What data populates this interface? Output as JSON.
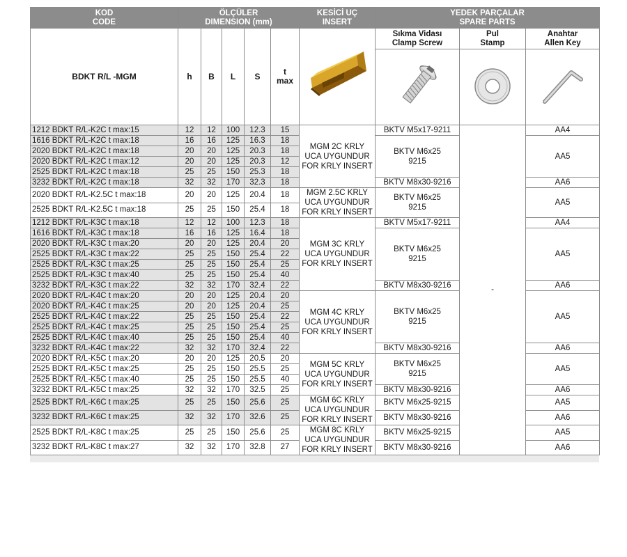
{
  "headers": {
    "code": [
      "KOD",
      "CODE"
    ],
    "dimensions": [
      "ÖLÇÜLER",
      "DIMENSION (mm)"
    ],
    "insert": [
      "KESİCİ UÇ",
      "INSERT"
    ],
    "spare_parts": [
      "YEDEK PARÇALAR",
      "SPARE PARTS"
    ],
    "clamp_screw": [
      "Sıkma Vidası",
      "Clamp Screw"
    ],
    "stamp": [
      "Pul",
      "Stamp"
    ],
    "allen_key": [
      "Anahtar",
      "Allen Key"
    ],
    "model": "BDKT R/L -MGM",
    "h": "h",
    "B": "B",
    "L": "L",
    "S": "S",
    "tmax": [
      "t",
      "max"
    ]
  },
  "icons": {
    "insert": "insert-image",
    "screw": "screw-icon",
    "washer": "washer-icon",
    "key": "allen-key-icon"
  },
  "colors": {
    "header_bg": "#8c8c8c",
    "row_shade": "#e3e3e3",
    "insert_gold": "#c9961f"
  },
  "stamp_value": "-",
  "rows": [
    {
      "code": "1212 BDKT R/L-K2C t max:15",
      "h": "12",
      "B": "12",
      "L": "100",
      "S": "12.3",
      "t": "15"
    },
    {
      "code": "1616 BDKT R/L-K2C t max:18",
      "h": "16",
      "B": "16",
      "L": "125",
      "S": "16.3",
      "t": "18"
    },
    {
      "code": "2020 BDKT R/L-K2C t max:18",
      "h": "20",
      "B": "20",
      "L": "125",
      "S": "20.3",
      "t": "18"
    },
    {
      "code": "2020 BDKT R/L-K2C t max:12",
      "h": "20",
      "B": "20",
      "L": "125",
      "S": "20.3",
      "t": "12"
    },
    {
      "code": "2525 BDKT R/L-K2C t max:18",
      "h": "25",
      "B": "25",
      "L": "150",
      "S": "25.3",
      "t": "18"
    },
    {
      "code": "3232 BDKT R/L-K2C t max:18",
      "h": "32",
      "B": "32",
      "L": "170",
      "S": "32.3",
      "t": "18"
    },
    {
      "code": "2020 BDKT R/L-K2.5C t max:18",
      "h": "20",
      "B": "20",
      "L": "125",
      "S": "20.4",
      "t": "18"
    },
    {
      "code": "2525 BDKT R/L-K2.5C t max:18",
      "h": "25",
      "B": "25",
      "L": "150",
      "S": "25.4",
      "t": "18"
    },
    {
      "code": "1212 BDKT R/L-K3C t max:18",
      "h": "12",
      "B": "12",
      "L": "100",
      "S": "12.3",
      "t": "18"
    },
    {
      "code": "1616 BDKT R/L-K3C t max:18",
      "h": "16",
      "B": "16",
      "L": "125",
      "S": "16.4",
      "t": "18"
    },
    {
      "code": "2020 BDKT R/L-K3C t max:20",
      "h": "20",
      "B": "20",
      "L": "125",
      "S": "20.4",
      "t": "20"
    },
    {
      "code": "2525 BDKT R/L-K3C t max:22",
      "h": "25",
      "B": "25",
      "L": "150",
      "S": "25.4",
      "t": "22"
    },
    {
      "code": "2525 BDKT R/L-K3C t max:25",
      "h": "25",
      "B": "25",
      "L": "150",
      "S": "25.4",
      "t": "25"
    },
    {
      "code": "2525 BDKT R/L-K3C t max:40",
      "h": "25",
      "B": "25",
      "L": "150",
      "S": "25.4",
      "t": "40"
    },
    {
      "code": "3232 BDKT R/L-K3C t max:22",
      "h": "32",
      "B": "32",
      "L": "170",
      "S": "32.4",
      "t": "22"
    },
    {
      "code": "2020 BDKT R/L-K4C t max:20",
      "h": "20",
      "B": "20",
      "L": "125",
      "S": "20.4",
      "t": "20"
    },
    {
      "code": "2020 BDKT R/L-K4C t max:25",
      "h": "20",
      "B": "20",
      "L": "125",
      "S": "20.4",
      "t": "25"
    },
    {
      "code": "2525 BDKT R/L-K4C t max:22",
      "h": "25",
      "B": "25",
      "L": "150",
      "S": "25.4",
      "t": "22"
    },
    {
      "code": "2525 BDKT R/L-K4C t max:25",
      "h": "25",
      "B": "25",
      "L": "150",
      "S": "25.4",
      "t": "25"
    },
    {
      "code": "2525 BDKT R/L-K4C t max:40",
      "h": "25",
      "B": "25",
      "L": "150",
      "S": "25.4",
      "t": "40"
    },
    {
      "code": "3232 BDKT R/L-K4C t max:22",
      "h": "32",
      "B": "32",
      "L": "170",
      "S": "32.4",
      "t": "22"
    },
    {
      "code": "2020 BDKT R/L-K5C t max:20",
      "h": "20",
      "B": "20",
      "L": "125",
      "S": "20.5",
      "t": "20"
    },
    {
      "code": "2525 BDKT R/L-K5C t max:25",
      "h": "25",
      "B": "25",
      "L": "150",
      "S": "25.5",
      "t": "25"
    },
    {
      "code": "2525 BDKT R/L-K5C t max:40",
      "h": "25",
      "B": "25",
      "L": "150",
      "S": "25.5",
      "t": "40"
    },
    {
      "code": "3232 BDKT R/L-K5C t max:25",
      "h": "32",
      "B": "32",
      "L": "170",
      "S": "32.5",
      "t": "25"
    },
    {
      "code": "2525 BDKT R/L-K6C t max:25",
      "h": "25",
      "B": "25",
      "L": "150",
      "S": "25.6",
      "t": "25"
    },
    {
      "code": "3232 BDKT R/L-K6C t max:25",
      "h": "32",
      "B": "32",
      "L": "170",
      "S": "32.6",
      "t": "25"
    },
    {
      "code": "2525 BDKT R/L-K8C t max:25",
      "h": "25",
      "B": "25",
      "L": "150",
      "S": "25.6",
      "t": "25"
    },
    {
      "code": "3232 BDKT R/L-K8C t max:27",
      "h": "32",
      "B": "32",
      "L": "170",
      "S": "32.8",
      "t": "27"
    }
  ],
  "inserts": [
    [
      "MGM 2C KRLY",
      "UCA UYGUNDUR",
      "FOR KRLY INSERT"
    ],
    [
      "MGM 2.5C KRLY",
      "UCA UYGUNDUR",
      "FOR KRLY INSERT"
    ],
    [
      "MGM 3C KRLY",
      "UCA UYGUNDUR",
      "FOR KRLY INSERT"
    ],
    [
      "MGM 4C KRLY",
      "UCA UYGUNDUR",
      "FOR KRLY INSERT"
    ],
    [
      "MGM 5C KRLY",
      "UCA UYGUNDUR",
      "FOR KRLY INSERT"
    ],
    [
      "MGM 6C KRLY",
      "UCA UYGUNDUR",
      "FOR KRLY INSERT"
    ],
    [
      "MGM 8C KRLY",
      "UCA UYGUNDUR",
      "FOR KRLY INSERT"
    ]
  ],
  "screws": [
    "BKTV M5x17-9211",
    [
      "BKTV M6x25",
      "9215"
    ],
    "BKTV M8x30-9216",
    [
      "BKTV M6x25",
      "9215"
    ],
    "BKTV M5x17-9211",
    [
      "BKTV M6x25",
      "9215"
    ],
    "BKTV M8x30-9216",
    [
      "BKTV M6x25",
      "9215"
    ],
    "BKTV M8x30-9216",
    [
      "BKTV M6x25",
      "9215"
    ],
    "BKTV M8x30-9216",
    "BKTV M6x25-9215",
    "BKTV M8x30-9216",
    "BKTV M6x25-9215",
    "BKTV M8x30-9216"
  ],
  "keys": [
    "AA4",
    "AA5",
    "AA6",
    "AA5",
    "AA4",
    "AA5",
    "AA6",
    "AA5",
    "AA6",
    "AA5",
    "AA6",
    "AA5",
    "AA6",
    "AA5",
    "AA6"
  ]
}
